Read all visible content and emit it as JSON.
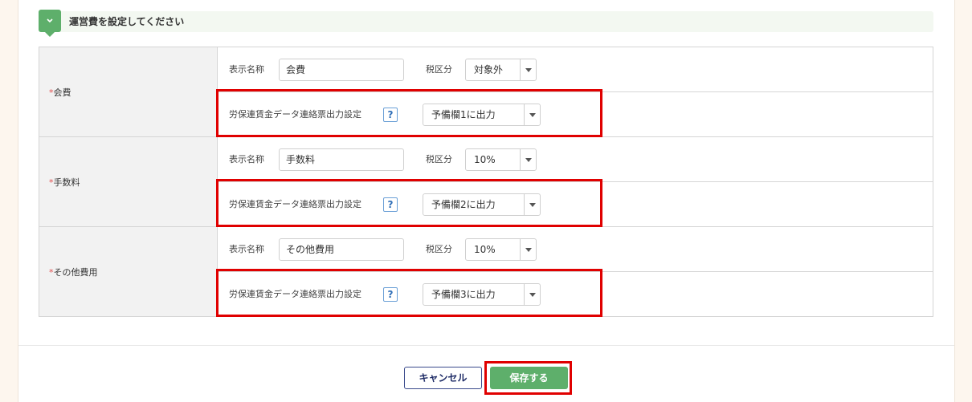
{
  "section": {
    "title": "運営費を設定してください"
  },
  "labels": {
    "display_name": "表示名称",
    "tax_category": "税区分",
    "output_setting": "労保連賃金データ連絡票出力設定",
    "help": "?"
  },
  "rows": [
    {
      "required_mark": "*",
      "name": "会費",
      "display_name_value": "会費",
      "tax_value": "対象外",
      "output_value": "予備欄1に出力"
    },
    {
      "required_mark": "*",
      "name": "手数料",
      "display_name_value": "手数料",
      "tax_value": "10%",
      "output_value": "予備欄2に出力"
    },
    {
      "required_mark": "*",
      "name": "その他費用",
      "display_name_value": "その他費用",
      "tax_value": "10%",
      "output_value": "予備欄3に出力"
    }
  ],
  "buttons": {
    "cancel": "キャンセル",
    "save": "保存する"
  },
  "colors": {
    "accent_green": "#5eaf6b",
    "highlight_red": "#e00000",
    "cancel_navy": "#1e2b66"
  }
}
